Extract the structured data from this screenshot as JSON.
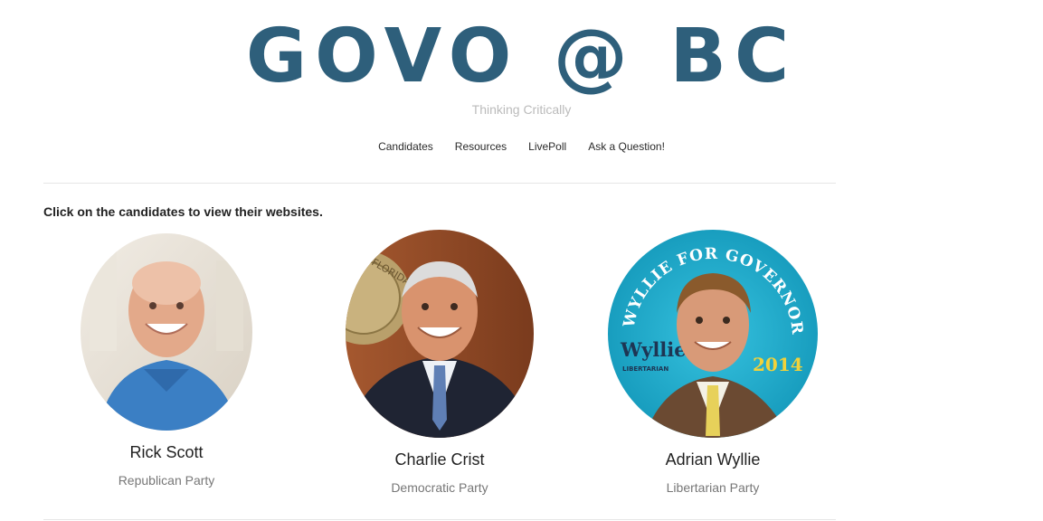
{
  "site": {
    "title": "GOVO @ BC",
    "tagline": "Thinking Critically"
  },
  "nav": [
    "Candidates",
    "Resources",
    "LivePoll",
    "Ask a Question!"
  ],
  "intro": "Click on the candidates to view their websites.",
  "candidates": [
    {
      "name": "Rick Scott",
      "party": "Republican Party"
    },
    {
      "name": "Charlie Crist",
      "party": "Democratic Party"
    },
    {
      "name": "Adrian Wyllie",
      "party": "Libertarian Party"
    }
  ],
  "badge": {
    "arc_text": "WYLLIE FOR GOVERNOR",
    "logo": "Wyllie",
    "logo_sub": "LIBERTARIAN",
    "year": "2014"
  },
  "seal": {
    "text": "FLORIDA"
  },
  "colors": {
    "brand": "#2e5f7b",
    "tagline": "#bbbbbb",
    "badge_bg": "#1aa6c6",
    "badge_year": "#f2d23a"
  }
}
